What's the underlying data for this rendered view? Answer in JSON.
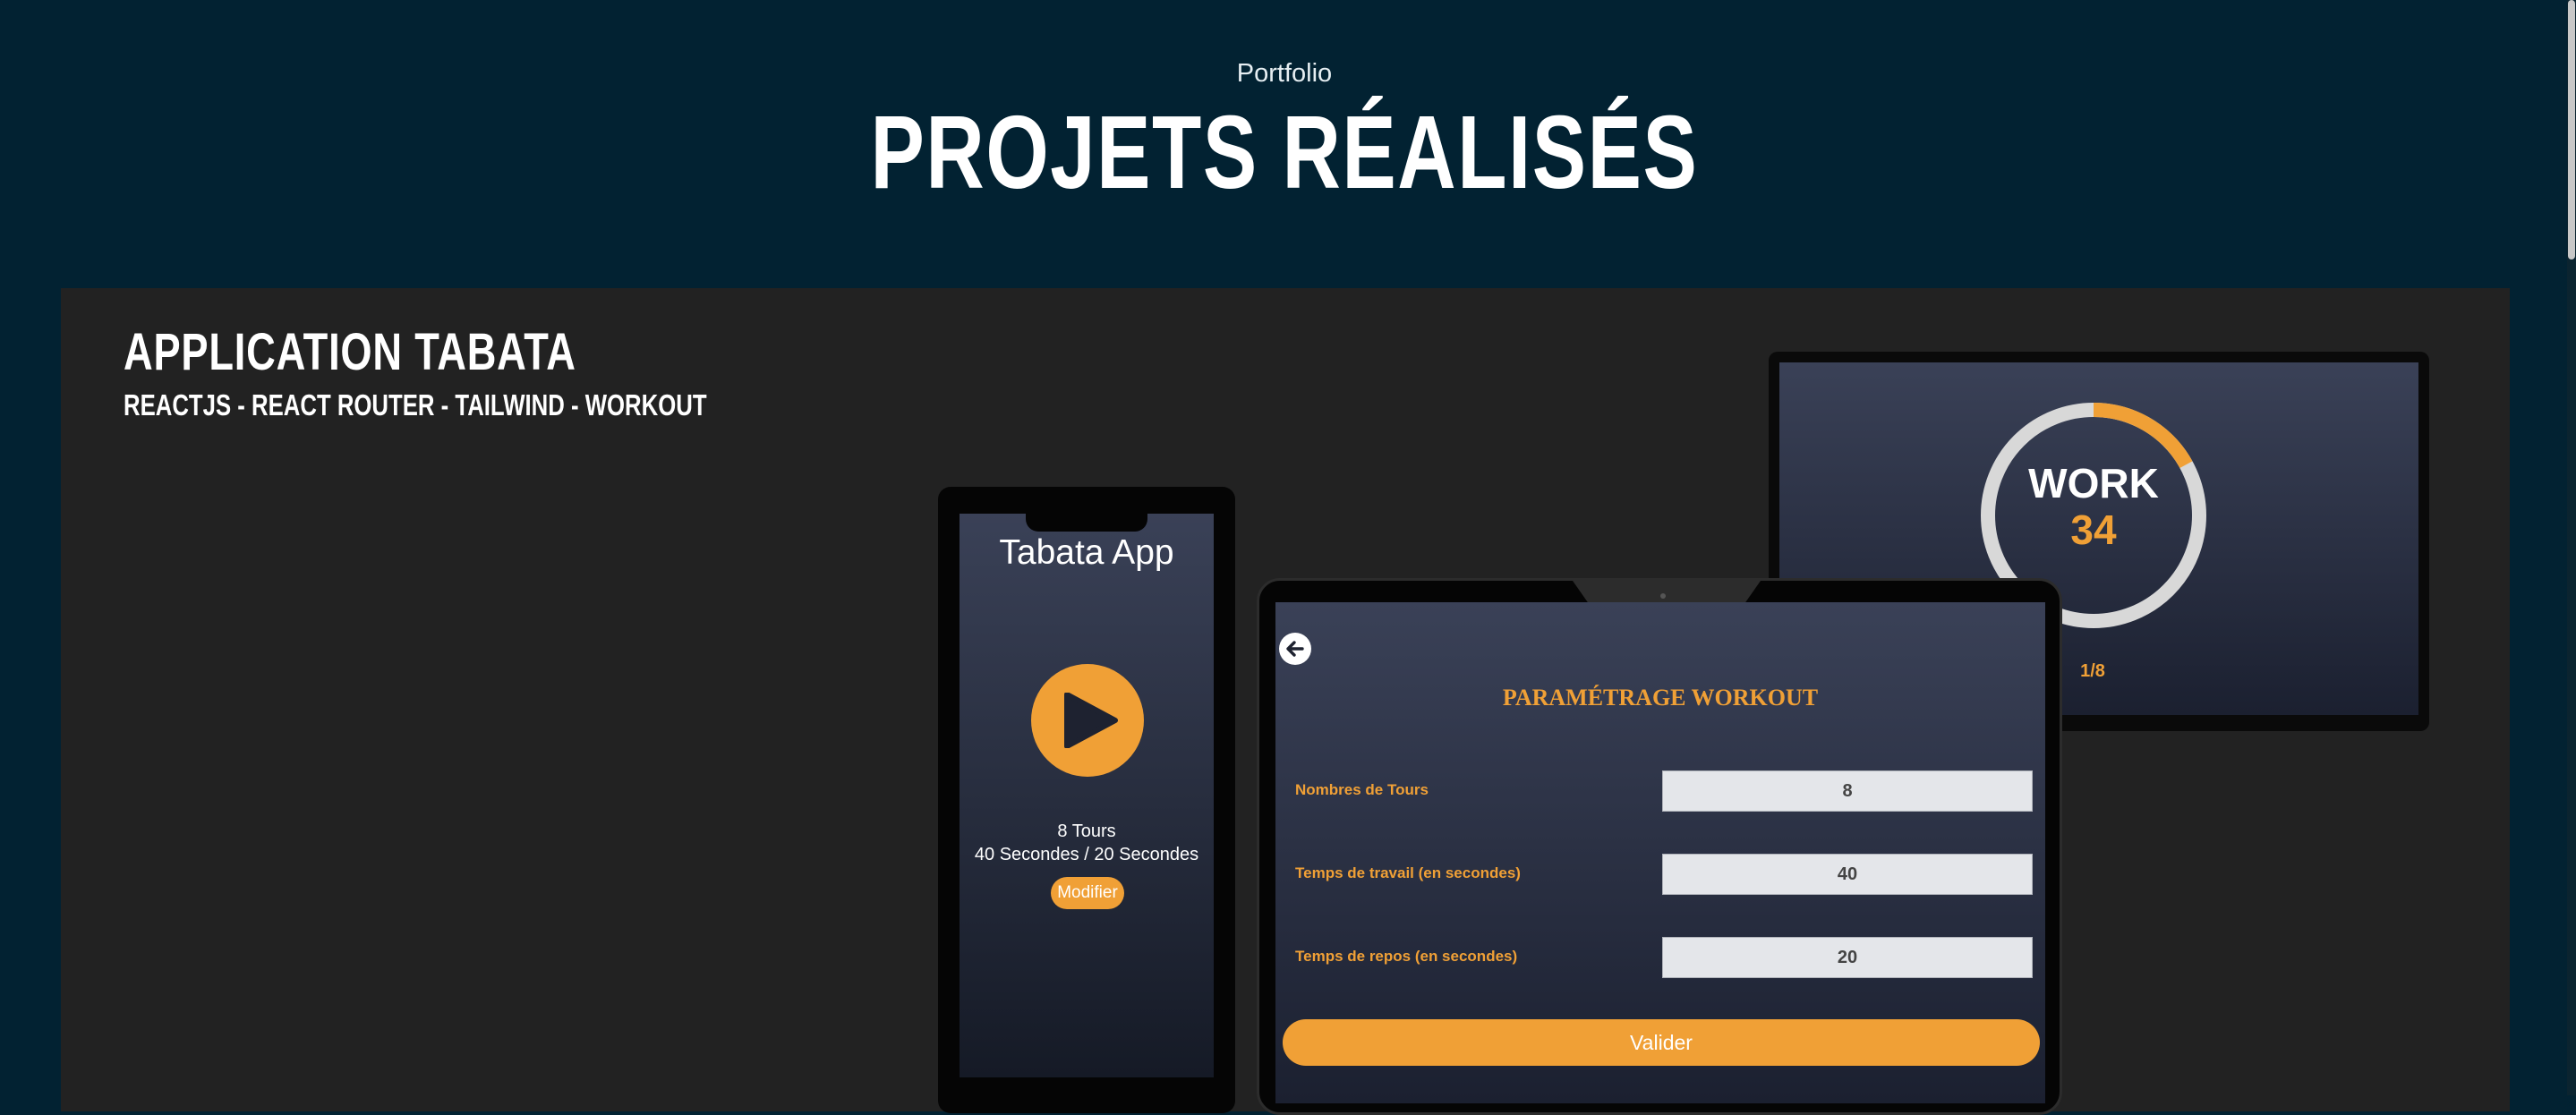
{
  "header": {
    "label": "Portfolio",
    "title": "PROJETS RÉALISÉS"
  },
  "project": {
    "title": "APPLICATION TABATA",
    "tags": "REACTJS - REACT ROUTER - TAILWIND - WORKOUT"
  },
  "timer_screen": {
    "phase": "WORK",
    "count": "34",
    "round": "1/8",
    "progress_fraction": 0.17
  },
  "phone_screen": {
    "title": "Tabata App",
    "rounds": "8 Tours",
    "times": "40 Secondes / 20 Secondes",
    "edit_label": "Modifier"
  },
  "tablet_screen": {
    "heading": "PARAMÉTRAGE WORKOUT",
    "fields": [
      {
        "label": "Nombres de Tours",
        "value": "8"
      },
      {
        "label": "Temps de travail (en secondes)",
        "value": "40"
      },
      {
        "label": "Temps de repos (en secondes)",
        "value": "20"
      }
    ],
    "validate_label": "Valider"
  },
  "colors": {
    "accent": "#f0a036",
    "background": "#022232",
    "card": "#222222"
  }
}
